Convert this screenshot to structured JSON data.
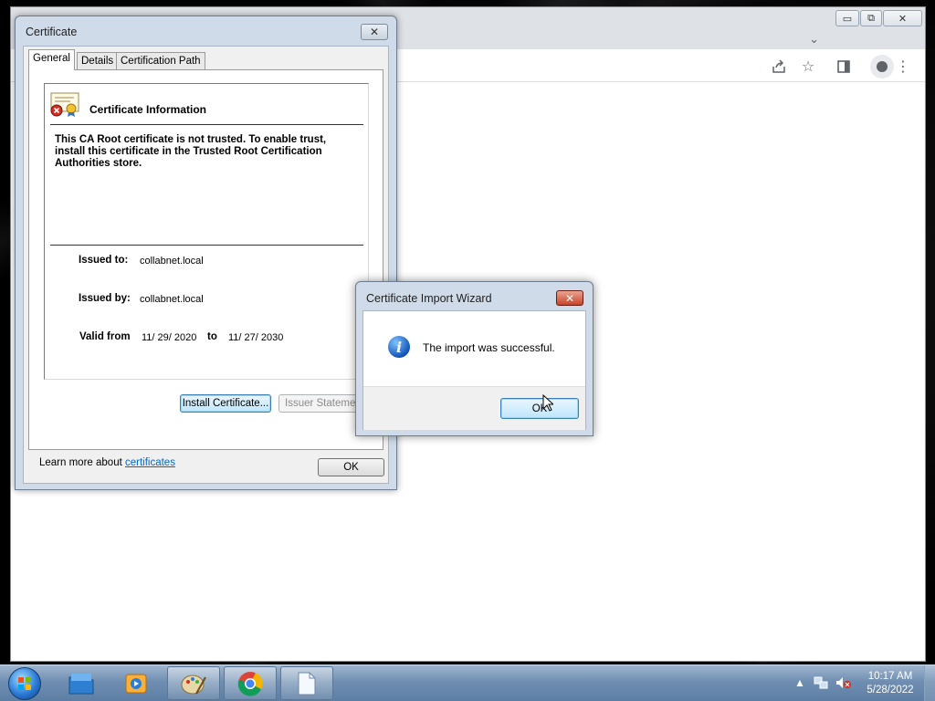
{
  "browser": {
    "controls": {
      "minimize": "▭",
      "restore": "⧉",
      "close": "✕"
    },
    "toolbar_icons": [
      "share-icon",
      "star-icon",
      "side-panel-icon",
      "profile-icon",
      "menu-icon"
    ]
  },
  "certificate_dialog": {
    "title": "Certificate",
    "close_label": "✕",
    "tabs": [
      "General",
      "Details",
      "Certification Path"
    ],
    "info_heading": "Certificate Information",
    "info_message": "This CA Root certificate is not trusted. To enable trust, install this certificate in the Trusted Root Certification Authorities store.",
    "issued_to_label": "Issued to:",
    "issued_to_value": "collabnet.local",
    "issued_by_label": "Issued by:",
    "issued_by_value": "collabnet.local",
    "valid_from_label": "Valid from",
    "valid_from_value": "11/ 29/ 2020",
    "valid_to_label": "to",
    "valid_to_value": "11/ 27/ 2030",
    "install_button": "Install Certificate...",
    "issuer_statement_button": "Issuer Statement",
    "learn_more_text": "Learn more about ",
    "learn_more_link": "certificates",
    "ok_button": "OK"
  },
  "wizard": {
    "title": "Certificate Import Wizard",
    "close_label": "✕",
    "message": "The import was successful.",
    "ok_button": "OK"
  },
  "taskbar": {
    "apps": [
      "start-orb",
      "explorer-icon",
      "media-player-icon",
      "paint-icon",
      "chrome-icon",
      "document-icon"
    ],
    "time": "10:17 AM",
    "date": "5/28/2022"
  }
}
